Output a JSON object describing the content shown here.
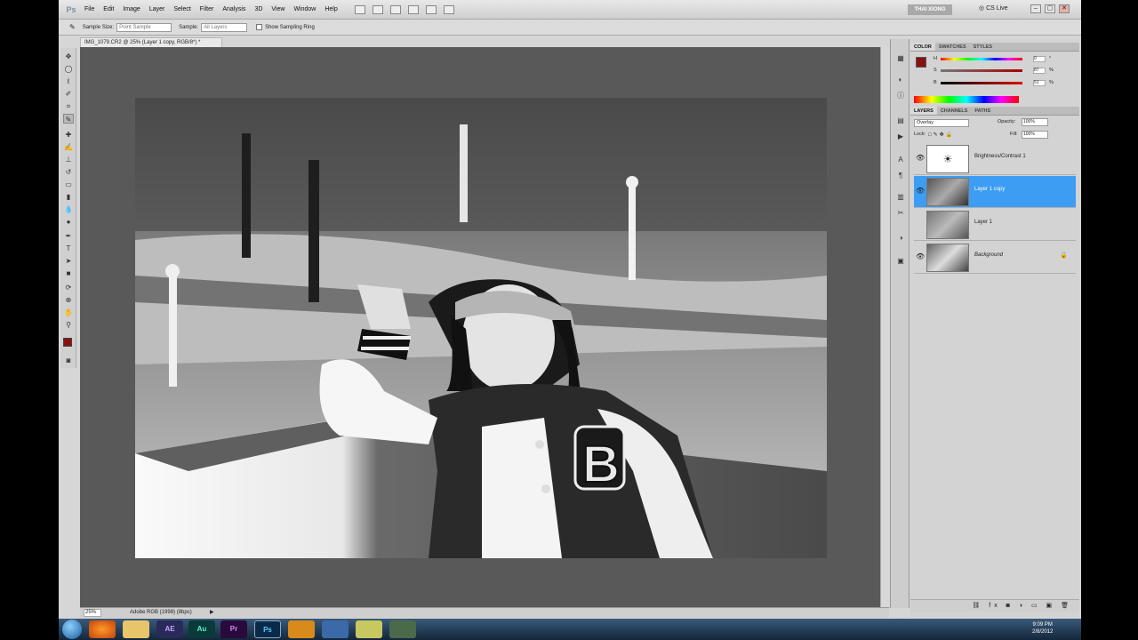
{
  "menubar": {
    "logo": "Ps",
    "items": [
      "File",
      "Edit",
      "Image",
      "Layer",
      "Select",
      "Filter",
      "Analysis",
      "3D",
      "View",
      "Window",
      "Help"
    ],
    "user": "THAI XIONG",
    "cslive": "CS Live",
    "minimize": "–",
    "restore": "▢",
    "close": "✕"
  },
  "options": {
    "sample_size_label": "Sample Size:",
    "sample_size_value": "Point Sample",
    "sample_label": "Sample:",
    "sample_value": "All Layers",
    "ring_label": "Show Sampling Ring"
  },
  "document": {
    "tab_title": "IMG_1079.CR2 @ 25% (Layer 1 copy, RGB/8*) *",
    "zoom": "25%",
    "profile": "Adobe RGB (1998) (8bpc)"
  },
  "color_panel": {
    "tabs": [
      "COLOR",
      "SWATCHES",
      "STYLES"
    ],
    "h_label": "H",
    "s_label": "S",
    "b_label": "B",
    "h_value": "0",
    "s_value": "87",
    "b_value": "51",
    "h_unit": "°",
    "s_unit": "%",
    "b_unit": "%",
    "fg_color": "#8b1010",
    "bg_color": "#ffffff"
  },
  "layers_panel": {
    "tabs": [
      "LAYERS",
      "CHANNELS",
      "PATHS"
    ],
    "blend_mode": "Overlay",
    "opacity_label": "Opacity:",
    "opacity_value": "100%",
    "lock_label": "Lock:",
    "fill_label": "Fill:",
    "fill_value": "100%",
    "layers": [
      {
        "name": "Brightness/Contrast 1",
        "selected": false,
        "visible": true
      },
      {
        "name": "Layer 1 copy",
        "selected": true,
        "visible": true
      },
      {
        "name": "Layer 1",
        "selected": false,
        "visible": false
      },
      {
        "name": "Background",
        "selected": false,
        "visible": true
      }
    ]
  },
  "taskbar": {
    "apps": [
      "AE",
      "Au",
      "Pr",
      "Ps"
    ],
    "time": "9:09 PM",
    "date": "2/8/2012"
  },
  "colors": {
    "selection_blue": "#3d9df3",
    "canvas_gray": "#595959"
  }
}
